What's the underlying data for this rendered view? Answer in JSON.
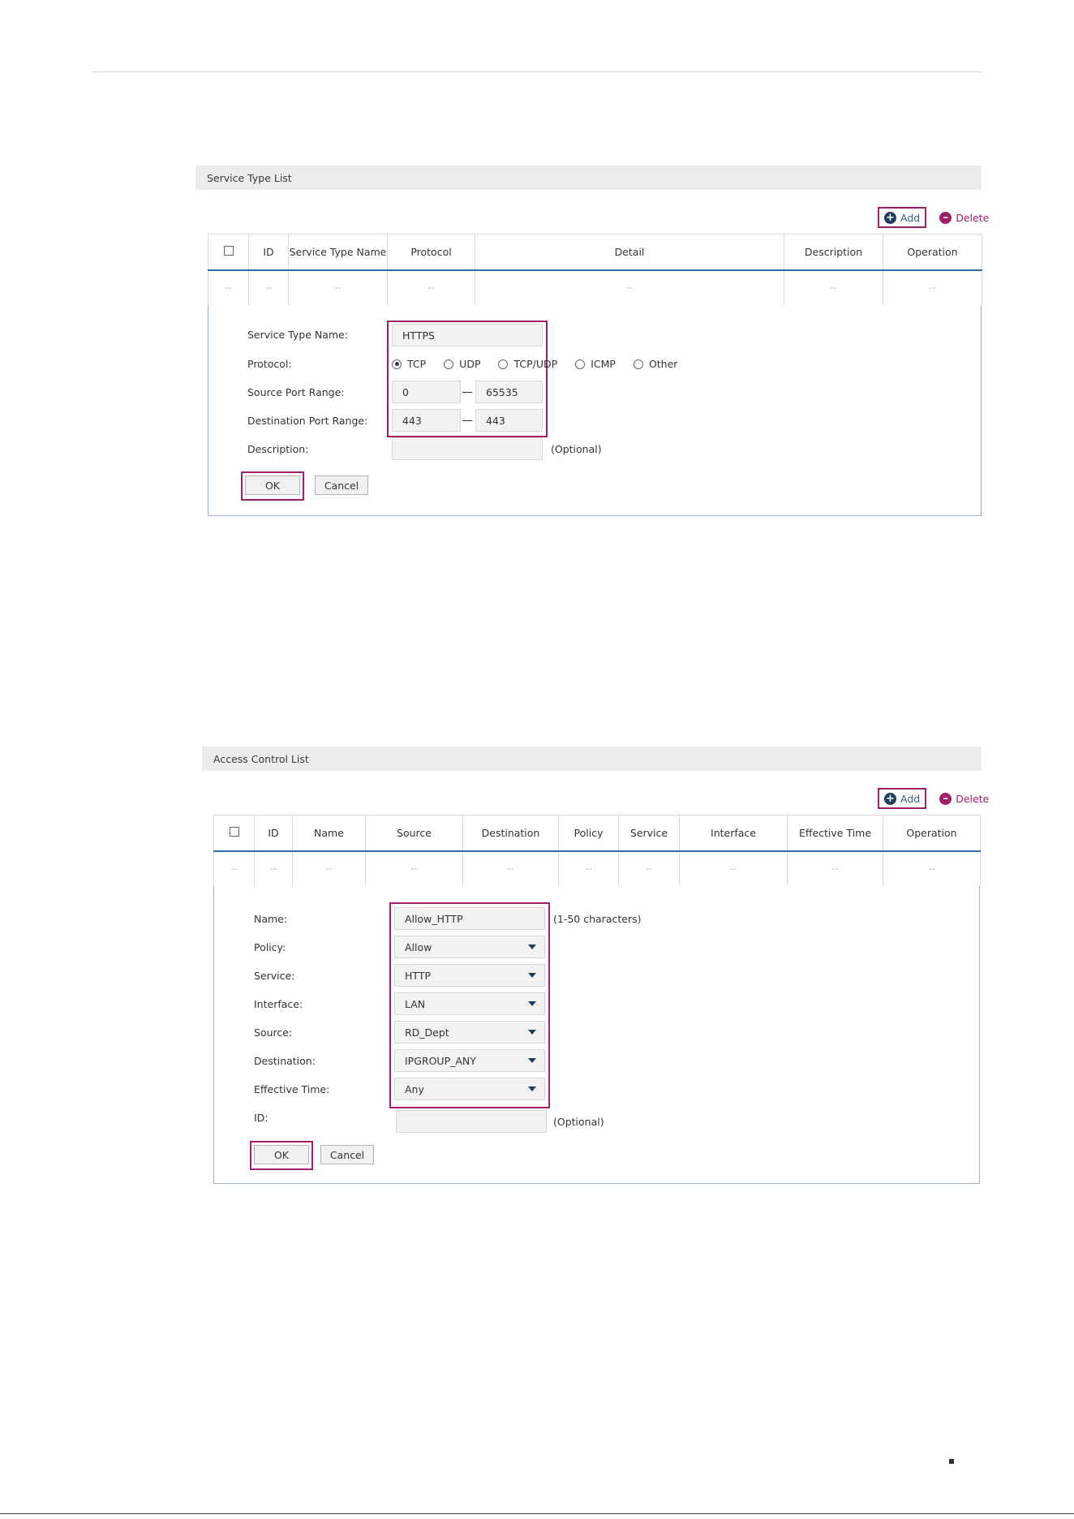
{
  "service_section": {
    "title": "Service Type List",
    "add_label": "Add",
    "delete_label": "Delete",
    "columns": [
      "ID",
      "Service Type Name",
      "Protocol",
      "Detail",
      "Description",
      "Operation"
    ],
    "empty_row": [
      "--",
      "--",
      "--",
      "--",
      "--",
      "--",
      "--"
    ],
    "form": {
      "name_label": "Service Type Name:",
      "name_value": "HTTPS",
      "protocol_label": "Protocol:",
      "protocols": [
        "TCP",
        "UDP",
        "TCP/UDP",
        "ICMP",
        "Other"
      ],
      "selected_protocol": "TCP",
      "source_port_label": "Source Port Range:",
      "source_port_from": "0",
      "source_port_to": "65535",
      "dest_port_label": "Destination Port Range:",
      "dest_port_from": "443",
      "dest_port_to": "443",
      "description_label": "Description:",
      "description_value": "",
      "description_hint": "(Optional)",
      "ok_label": "OK",
      "cancel_label": "Cancel"
    }
  },
  "acl_section": {
    "title": "Access Control List",
    "add_label": "Add",
    "delete_label": "Delete",
    "columns": [
      "ID",
      "Name",
      "Source",
      "Destination",
      "Policy",
      "Service",
      "Interface",
      "Effective Time",
      "Operation"
    ],
    "empty_row": [
      "--",
      "--",
      "--",
      "--",
      "--",
      "--",
      "--",
      "--",
      "--",
      "--"
    ],
    "form": {
      "name_label": "Name:",
      "name_value": "Allow_HTTP",
      "name_hint": "(1-50 characters)",
      "policy_label": "Policy:",
      "policy_value": "Allow",
      "service_label": "Service:",
      "service_value": "HTTP",
      "interface_label": "Interface:",
      "interface_value": "LAN",
      "source_label": "Source:",
      "source_value": "RD_Dept",
      "destination_label": "Destination:",
      "destination_value": "IPGROUP_ANY",
      "effective_time_label": "Effective Time:",
      "effective_time_value": "Any",
      "id_label": "ID:",
      "id_value": "",
      "id_hint": "(Optional)",
      "ok_label": "OK",
      "cancel_label": "Cancel"
    }
  },
  "colors": {
    "highlight": "#a0206a",
    "accent": "#1f3e5e",
    "header_bg": "#ececec"
  }
}
